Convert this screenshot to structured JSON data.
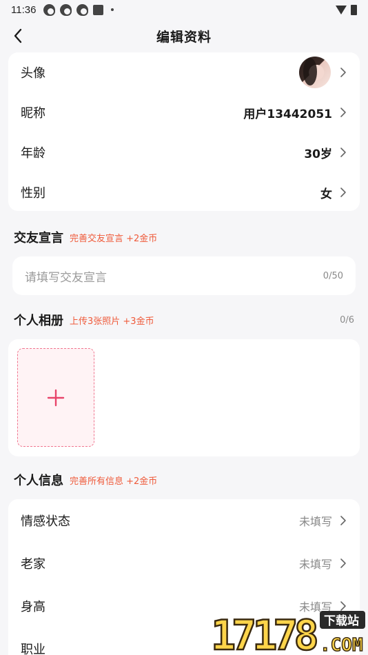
{
  "status_bar": {
    "time": "11:36"
  },
  "header": {
    "title": "编辑资料"
  },
  "basic": {
    "avatar_label": "头像",
    "nickname_label": "昵称",
    "nickname_value": "用户13442051",
    "age_label": "年龄",
    "age_value": "30岁",
    "gender_label": "性别",
    "gender_value": "女"
  },
  "motto": {
    "title": "交友宣言",
    "hint": "完善交友宣言 +2金币",
    "placeholder": "请填写交友宣言",
    "count": "0/50"
  },
  "album": {
    "title": "个人相册",
    "hint": "上传3张照片 +3金币",
    "count": "0/6"
  },
  "info": {
    "title": "个人信息",
    "hint": "完善所有信息 +2金币",
    "rows": [
      {
        "label": "情感状态",
        "value": "未填写"
      },
      {
        "label": "老家",
        "value": "未填写"
      },
      {
        "label": "身高",
        "value": "未填写"
      },
      {
        "label": "职业",
        "value": ""
      }
    ]
  },
  "watermark": {
    "number": "17178",
    "tag": "下载站",
    "domain": ".COM"
  },
  "colors": {
    "accent_hint": "#ef5a3a",
    "add_plus": "#e8446a",
    "add_border": "#f0748e",
    "page_bg": "#f6f6f8"
  }
}
